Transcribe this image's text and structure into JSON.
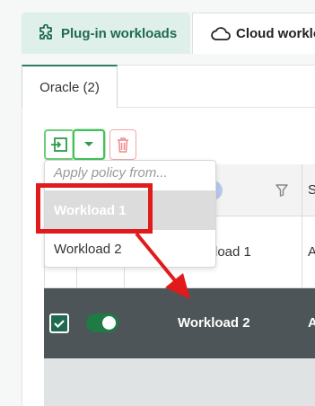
{
  "top_tabs": {
    "plugin_label": "Plug-in workloads",
    "cloud_label": "Cloud workloads"
  },
  "subtab": {
    "label": "Oracle (2)"
  },
  "dropdown": {
    "hint": "Apply policy from...",
    "items": [
      "Workload 1",
      "Workload 2"
    ]
  },
  "table": {
    "header_col_s": "S",
    "rows": [
      {
        "name": "Workload 1",
        "visible_name": "load 1",
        "col_a": "A",
        "checked": false
      },
      {
        "name": "Workload 2",
        "col_a": "A",
        "checked": true,
        "enabled": true
      }
    ]
  },
  "colors": {
    "accent_green": "#2e7d5b",
    "annotation_red": "#e11b1b",
    "selected_row": "#4e5558"
  },
  "icons": {
    "plugin_tab": "puzzle-icon",
    "cloud_tab": "cloud-icon",
    "apply": "apply-policy-icon",
    "dropdown": "caret-down-icon",
    "delete": "trash-icon",
    "info": "info-icon",
    "filter": "filter-icon",
    "checkbox": "check-icon"
  }
}
